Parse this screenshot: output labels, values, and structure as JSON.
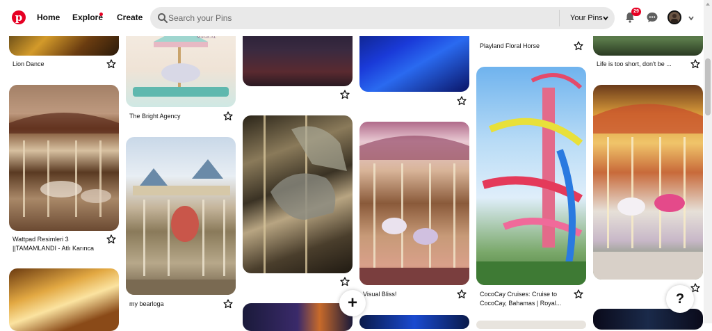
{
  "app": {
    "brand_color": "#e60023"
  },
  "header": {
    "logo_icon": "pinterest-logo",
    "nav": {
      "home": "Home",
      "explore": "Explore",
      "create": "Create"
    },
    "search": {
      "placeholder": "Search your Pins",
      "scope_label": "Your Pins"
    },
    "notifications": {
      "count": "29"
    }
  },
  "pins": [
    {
      "title": "Lion Dance"
    },
    {
      "title": "The Bright Agency"
    },
    {
      "title": "Wattpad Resimleri 3"
    },
    {
      "title": "||TAMAMLANDI - Atlı Karınca"
    },
    {
      "title": "my bearloga"
    },
    {
      "title": "Visual Bliss!"
    },
    {
      "title": "Playland Floral Horse"
    },
    {
      "title": "CocoCay Cruises: Cruise to"
    },
    {
      "title": "CocoCay, Bahamas | Royal..."
    },
    {
      "title": "Life is too short, don't be ..."
    }
  ],
  "fab": {
    "label": "+"
  },
  "help": {
    "label": "?"
  }
}
